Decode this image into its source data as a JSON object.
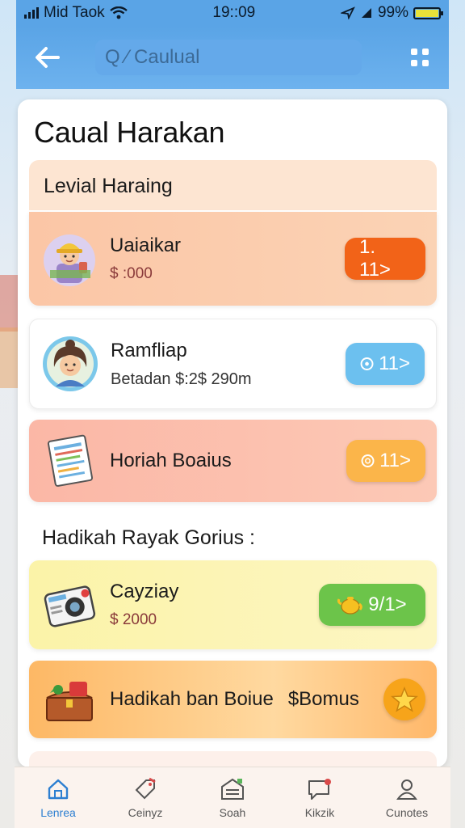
{
  "status": {
    "carrier": "Mid Taok",
    "time": "19::09",
    "battery": "99%",
    "battery_level": 0.99
  },
  "header": {
    "search_placeholder": "Q ∕ Caulual"
  },
  "page": {
    "title": "Caual Harakan"
  },
  "section1": {
    "heading": "Levial Haraing",
    "items": [
      {
        "title": "Uaiaikar",
        "subtitle": "$ :000",
        "action": "1. 11>",
        "icon": "worker-avatar-icon",
        "accent": "#f26318"
      },
      {
        "title": "Ramfliap",
        "subtitle": "Betadan  $:2$ 290m",
        "action": "11>",
        "icon": "woman-avatar-icon",
        "accent": "#6cc0ef"
      },
      {
        "title": "Horiah Boaius",
        "subtitle": "",
        "action": "11>",
        "icon": "document-list-icon",
        "accent": "#fbb54a"
      }
    ]
  },
  "section2": {
    "heading": "Hadikah Rayak Gorius  :",
    "items": [
      {
        "title": "Cayziay",
        "subtitle": "$ 2000",
        "action": "9/1>",
        "icon": "camera-icon",
        "accent": "#6cc44a"
      },
      {
        "title": "Hadikah ban Boiue",
        "extra": "$Bomus",
        "icon": "treasure-chest-icon",
        "action_icon": "star-icon"
      }
    ]
  },
  "nav": [
    {
      "label": "Lenrea",
      "icon": "home-icon",
      "active": true
    },
    {
      "label": "Ceinyz",
      "icon": "tag-icon",
      "active": false
    },
    {
      "label": "Soah",
      "icon": "store-icon",
      "active": false
    },
    {
      "label": "Kikzik",
      "icon": "chat-icon",
      "active": false
    },
    {
      "label": "Cunotes",
      "icon": "profile-icon",
      "active": false
    }
  ]
}
